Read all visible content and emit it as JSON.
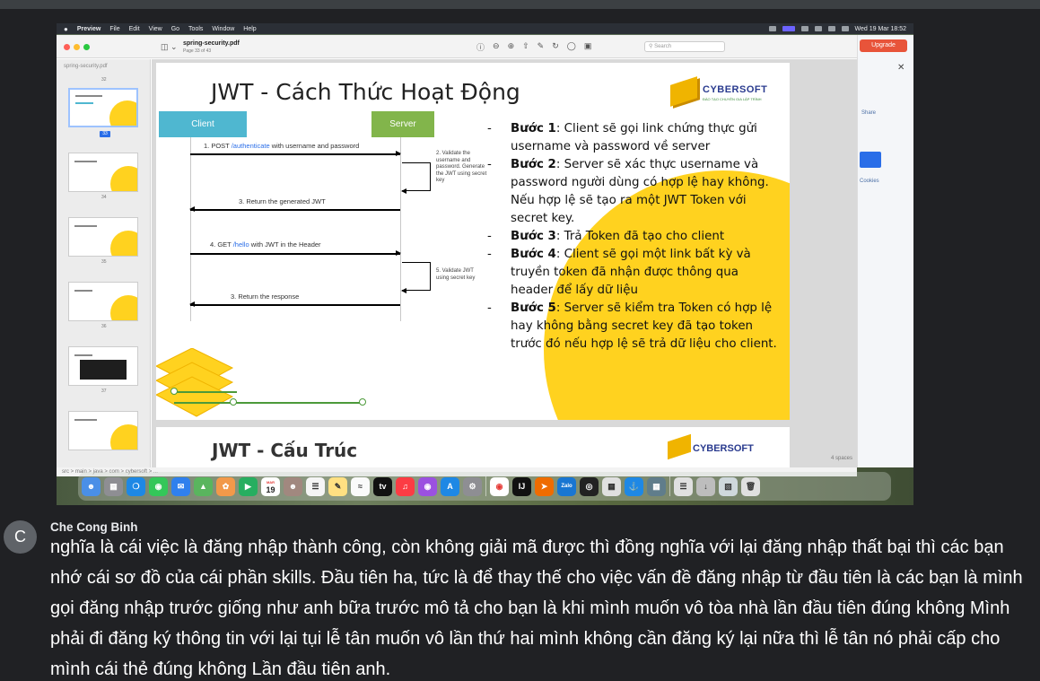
{
  "menubar": {
    "apple": "",
    "app_name": "Preview",
    "items": [
      "File",
      "Edit",
      "View",
      "Go",
      "Tools",
      "Window",
      "Help"
    ],
    "clock": "Wed 19 Mar 18:52"
  },
  "preview": {
    "filename": "spring-security.pdf",
    "page_info": "Page 33 of 43",
    "search_placeholder": "Search",
    "sidebar_title": "spring-security.pdf",
    "sidebar_pages": [
      "32",
      "33",
      "34",
      "35",
      "36",
      "37"
    ],
    "selected_page": "33",
    "path_bar": "src > main > java > com > cybersoft > ..."
  },
  "slide": {
    "title": "JWT - Cách Thức Hoạt Động",
    "brand": "CYBERSOFT",
    "brand_sub": "ĐÀO TẠO CHUYÊN GIA LẬP TRÌNH",
    "client_label": "Client",
    "server_label": "Server",
    "arrow1_pre": "1. POST ",
    "arrow1_link": "/authenticate",
    "arrow1_post": " with username and password",
    "note1": "2. Validate the username and password. Generate the JWT using secret key",
    "arrow2": "3. Return the generated JWT",
    "arrow3_pre": "4.  GET ",
    "arrow3_link": "/hello",
    "arrow3_post": " with JWT in the Header",
    "note2": "5. Validate JWT using secret key",
    "arrow4": "3. Return the response",
    "steps": [
      {
        "label": "Bước 1",
        "text": ": Client sẽ gọi link chứng thực gửi username và password về server"
      },
      {
        "label": "Bước 2",
        "text": ": Server sẽ xác thực username và password người dùng có hợp lệ hay không. Nếu hợp lệ sẽ tạo ra một JWT Token với secret key."
      },
      {
        "label": "Bước 3",
        "text": ": Trả Token đã tạo cho client"
      },
      {
        "label": "Bước 4",
        "text": ": Client sẽ gọi một link bất kỳ và truyền token đã nhận được thông qua header để lấy dữ liệu"
      },
      {
        "label": "Bước 5",
        "text": ": Server sẽ kiểm tra Token có hợp lệ hay không bằng secret key đã tạo token trước đó nếu hợp lệ sẽ trả dữ liệu cho client."
      }
    ],
    "next_title": "JWT - Cấu Trúc",
    "next_brand": "CYBERSOFT"
  },
  "right_app": {
    "upgrade_label": "Upgrade",
    "share_label": "Share",
    "cookies_label": "Cookies",
    "spaces_label": "4 spaces"
  },
  "dock": {
    "calendar_day": "19",
    "calendar_month": "MAR"
  },
  "caption": {
    "avatar_letter": "C",
    "speaker": "Che Cong Binh",
    "text": "nghĩa là cái việc là đăng nhập thành công, còn không giải mã được thì đồng nghĩa với lại đăng nhập thất bại thì các bạn nhớ cái sơ đồ của cái phần skills. Đầu tiên ha, tức là để thay thế cho việc vấn đề đăng nhập từ đầu tiên là các bạn là mình gọi đăng nhập trước giống như anh bữa trước mô tả cho bạn là khi mình muốn vô tòa nhà lần đầu tiên đúng không Mình phải đi đăng ký thông tin với lại tụi lễ tân muốn vô lần thứ hai mình không cần đăng ký lại nữa thì lễ tân nó phải cấp cho mình cái thẻ đúng không Lần đầu tiên anh."
  },
  "colors": {
    "accent_yellow": "#ffd21f",
    "client_box": "#4fb7d0",
    "server_box": "#82b54b",
    "brand_navy": "#2a3b8f",
    "upgrade_orange": "#e8543a"
  }
}
